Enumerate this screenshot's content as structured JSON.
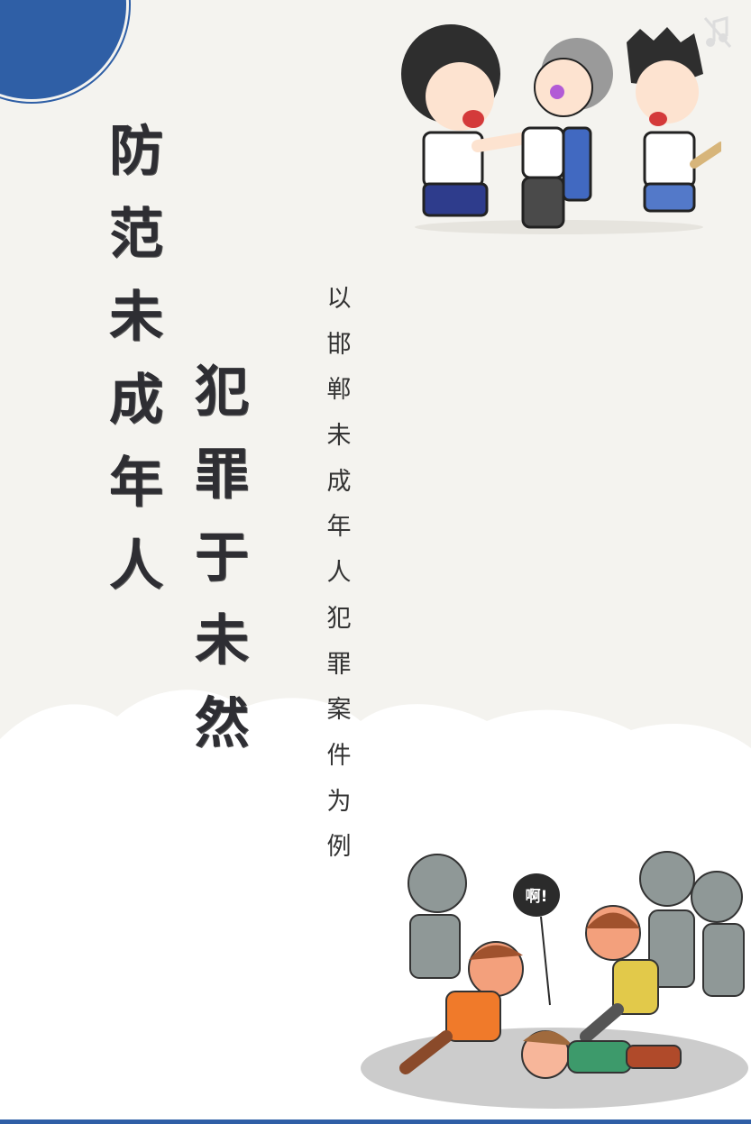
{
  "title_line1": [
    "防",
    "范",
    "未",
    "成",
    "年",
    "人"
  ],
  "title_line2": [
    "犯",
    "罪",
    "于",
    "未",
    "然"
  ],
  "subtitle": [
    "以",
    "邯",
    "郸",
    "未",
    "成",
    "年",
    "人",
    "犯",
    "罪",
    "案",
    "件",
    "为",
    "例"
  ],
  "speech_bubble": "啊!",
  "icons": {
    "music": "music-note-off-icon"
  },
  "colors": {
    "accent": "#2f5fa6",
    "background": "#f4f3ef",
    "text": "#2e2e33"
  }
}
